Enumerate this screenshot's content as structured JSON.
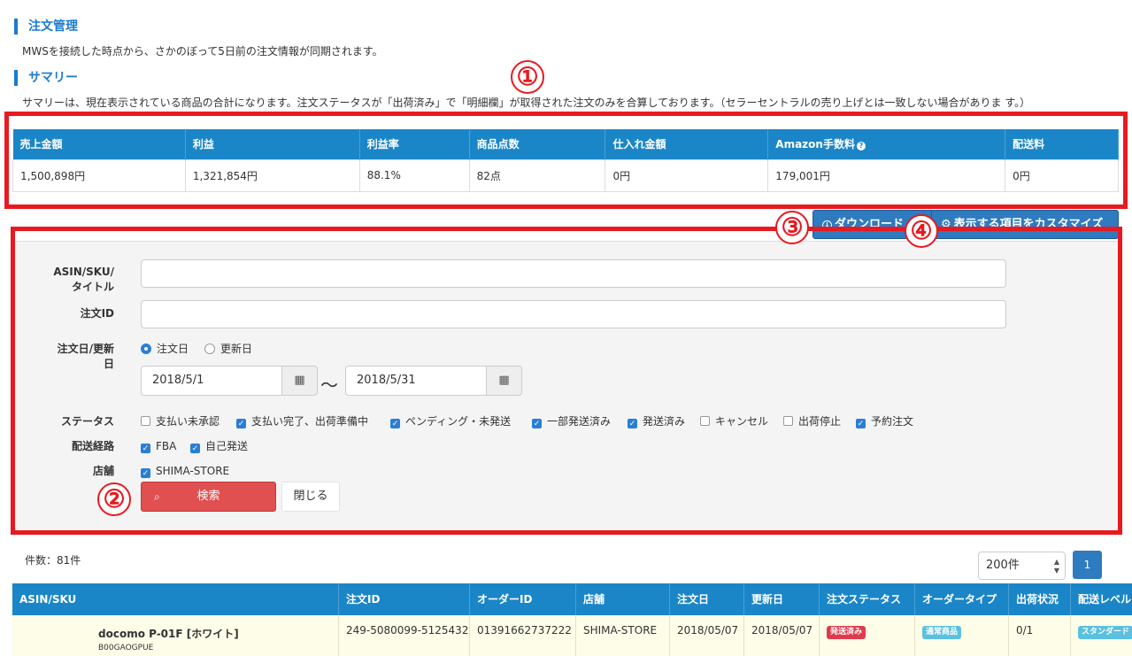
{
  "header": {
    "order_title": "注文管理",
    "order_note": "MWSを接続した時点から、さかのぼって5日前の注文情報が同期されます。",
    "summary_title": "サマリー",
    "summary_note": "サマリーは、現在表示されている商品の合計になります。注文ステータスが「出荷済み」で「明細欄」が取得された注文のみを合算しております。（セラーセントラルの売り上げとは一致しない場合がありま す。）"
  },
  "annotations": [
    "①",
    "②",
    "③",
    "④"
  ],
  "summary": {
    "headers": [
      "売上金額",
      "利益",
      "利益率",
      "商品点数",
      "仕入れ金額",
      "Amazon手数料",
      "配送料"
    ],
    "values": [
      "1,500,898円",
      "1,321,854円",
      "88.1%",
      "82点",
      "0円",
      "179,001円",
      "0円"
    ],
    "help_icon": "question-circle-icon"
  },
  "toolbar": {
    "download_label": "ダウンロード",
    "customize_label": "表示する項目をカスタマイズ",
    "download_icon": "download-circle-icon",
    "customize_icon": "gear-icon"
  },
  "search": {
    "asin_label_1": "ASIN/SKU/",
    "asin_label_2": "タイトル",
    "asin_value": "",
    "order_id_label": "注文ID",
    "order_id_value": "",
    "date_label_1": "注文日/更新",
    "date_label_2": "日",
    "date_options": [
      {
        "label": "注文日",
        "checked": true
      },
      {
        "label": "更新日",
        "checked": false
      }
    ],
    "date_from": "2018/5/1",
    "date_to": "2018/5/31",
    "tilde": "〜",
    "calendar_icon": "calendar-icon",
    "status_label": "ステータス",
    "status_options": [
      {
        "label": "支払い未承認",
        "checked": false
      },
      {
        "label": "支払い完了、出荷準備中",
        "checked": true
      },
      {
        "label": "ペンディング・未発送",
        "checked": true
      },
      {
        "label": "一部発送済み",
        "checked": true
      },
      {
        "label": "発送済み",
        "checked": true
      },
      {
        "label": "キャンセル",
        "checked": false
      },
      {
        "label": "出荷停止",
        "checked": false
      },
      {
        "label": "予約注文",
        "checked": true
      }
    ],
    "route_label": "配送経路",
    "route_options": [
      {
        "label": "FBA",
        "checked": true
      },
      {
        "label": "自己発送",
        "checked": true
      }
    ],
    "store_label": "店舗",
    "store_options": [
      {
        "label": "SHIMA-STORE",
        "checked": true
      }
    ],
    "search_button": "検索",
    "search_icon": "search-icon",
    "close_button": "閉じる"
  },
  "list": {
    "count_text": "件数：81件",
    "per_page": "200件",
    "page": "1",
    "headers": [
      "ASIN/SKU",
      "注文ID",
      "オーダーID",
      "店舗",
      "注文日",
      "更新日",
      "注文ステータス",
      "オーダータイプ",
      "出荷状況",
      "配送レベル"
    ],
    "rows": [
      {
        "title": "docomo P-01F [ホワイト]",
        "asin": "B00GAOGPUE",
        "order_id": "249-5080099-5125432",
        "amazon_order_id": "01391662737222",
        "store": "SHIMA-STORE",
        "order_date": "2018/05/07",
        "update_date": "2018/05/07",
        "status": "発送済み",
        "order_type": "通常商品",
        "shipping": "0/1",
        "delivery": "スタンダード"
      }
    ]
  },
  "colors": {
    "accent": "#1a7bd1",
    "table_header": "#1a86c8",
    "annotation_red": "#e8191f",
    "search_button": "#e05050",
    "status_badge": "#e03b4c",
    "type_badge": "#5bc0de"
  }
}
